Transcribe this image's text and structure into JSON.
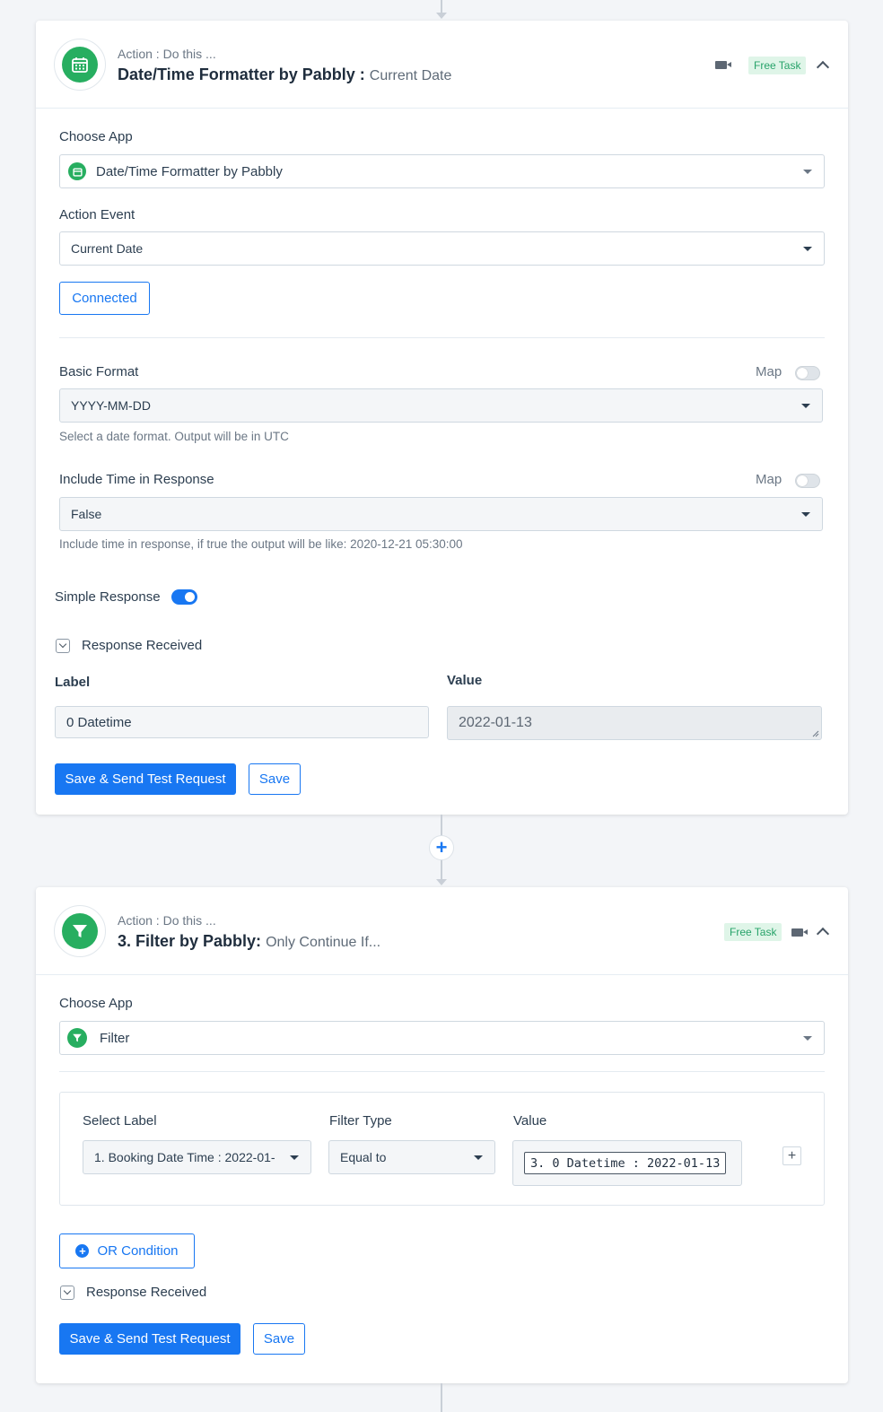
{
  "card1": {
    "subtitle": "Action : Do this ...",
    "title": "Date/Time Formatter by Pabbly :",
    "title_event": "Current Date",
    "badge": "Free Task",
    "choose_app_label": "Choose App",
    "choose_app_value": "Date/Time Formatter by Pabbly",
    "action_event_label": "Action Event",
    "action_event_value": "Current Date",
    "connected_label": "Connected",
    "basic_format_label": "Basic Format",
    "basic_format_value": "YYYY-MM-DD",
    "basic_format_help": "Select a date format. Output will be in UTC",
    "include_time_label": "Include Time in Response",
    "include_time_value": "False",
    "include_time_help": "Include time in response, if true the output will be like: 2020-12-21 05:30:00",
    "map_label": "Map",
    "simple_response_label": "Simple Response",
    "response_received_label": "Response Received",
    "label_header": "Label",
    "value_header": "Value",
    "label_value": "0 Datetime",
    "value_value": "2022-01-13",
    "save_send_label": "Save & Send Test Request",
    "save_label": "Save"
  },
  "card2": {
    "subtitle": "Action : Do this ...",
    "title": "3. Filter by Pabbly:",
    "title_event": "Only Continue If...",
    "badge": "Free Task",
    "choose_app_label": "Choose App",
    "choose_app_value": "Filter",
    "select_label_header": "Select Label",
    "filter_type_header": "Filter Type",
    "value_header": "Value",
    "select_label_value": "1. Booking Date Time : 2022-01-",
    "filter_type_value": "Equal to",
    "value_value": "3. 0 Datetime : 2022-01-13",
    "add_condition_symbol": "+",
    "or_condition_label": "OR Condition",
    "response_received_label": "Response Received",
    "save_send_label": "Save & Send Test Request",
    "save_label": "Save"
  },
  "connector": {
    "add_symbol": "+"
  },
  "colors": {
    "accent": "#1877f2",
    "app_green": "#27ae60",
    "badge_bg": "#dff5e8",
    "badge_text": "#28a36a"
  },
  "icons": [
    "calendar-icon",
    "filter-icon",
    "video-icon",
    "chevron-up-icon",
    "chevron-down-icon",
    "plus-icon",
    "plus-circle-icon"
  ]
}
